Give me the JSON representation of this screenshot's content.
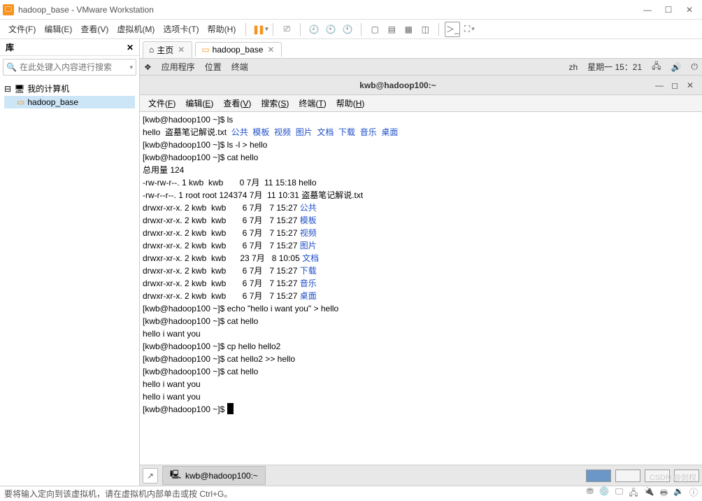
{
  "window": {
    "title": "hadoop_base - VMware Workstation"
  },
  "menubar": [
    {
      "label": "文件(F)"
    },
    {
      "label": "编辑(E)"
    },
    {
      "label": "查看(V)"
    },
    {
      "label": "虚拟机(M)"
    },
    {
      "label": "选项卡(T)"
    },
    {
      "label": "帮助(H)"
    }
  ],
  "sidebar": {
    "title": "库",
    "search_placeholder": "在此处键入内容进行搜索",
    "tree": {
      "root": "我的计算机",
      "child": "hadoop_base"
    }
  },
  "tabs": [
    {
      "label": "主页",
      "closable": true,
      "active": false
    },
    {
      "label": "hadoop_base",
      "closable": true,
      "active": true
    }
  ],
  "gnome": {
    "menus": [
      "应用程序",
      "位置",
      "终端"
    ],
    "lang": "zh",
    "clock": "星期一 15：21"
  },
  "term_window": {
    "title": "kwb@hadoop100:~",
    "menus": [
      {
        "t": "文件",
        "u": "F"
      },
      {
        "t": "编辑",
        "u": "E"
      },
      {
        "t": "查看",
        "u": "V"
      },
      {
        "t": "搜索",
        "u": "S"
      },
      {
        "t": "终端",
        "u": "T"
      },
      {
        "t": "帮助",
        "u": "H"
      }
    ]
  },
  "terminal_lines": [
    {
      "segs": [
        {
          "t": "[kwb@hadoop100 ~]$ ls"
        }
      ]
    },
    {
      "segs": [
        {
          "t": "hello  盗墓笔记解说.txt  "
        },
        {
          "t": "公共  模板  视频  图片  文档  下载  音乐  桌面",
          "c": "blue"
        }
      ]
    },
    {
      "segs": [
        {
          "t": "[kwb@hadoop100 ~]$ ls -l > hello"
        }
      ]
    },
    {
      "segs": [
        {
          "t": "[kwb@hadoop100 ~]$ cat hello"
        }
      ]
    },
    {
      "segs": [
        {
          "t": "总用量 124"
        }
      ]
    },
    {
      "segs": [
        {
          "t": "-rw-rw-r--. 1 kwb  kwb       0 7月  11 15:18 hello"
        }
      ]
    },
    {
      "segs": [
        {
          "t": "-rw-r--r--. 1 root root 124374 7月  11 10:31 盗墓笔记解说.txt"
        }
      ]
    },
    {
      "segs": [
        {
          "t": "drwxr-xr-x. 2 kwb  kwb       6 7月   7 15:27 "
        },
        {
          "t": "公共",
          "c": "blue"
        }
      ]
    },
    {
      "segs": [
        {
          "t": "drwxr-xr-x. 2 kwb  kwb       6 7月   7 15:27 "
        },
        {
          "t": "模板",
          "c": "blue"
        }
      ]
    },
    {
      "segs": [
        {
          "t": "drwxr-xr-x. 2 kwb  kwb       6 7月   7 15:27 "
        },
        {
          "t": "视频",
          "c": "blue"
        }
      ]
    },
    {
      "segs": [
        {
          "t": "drwxr-xr-x. 2 kwb  kwb       6 7月   7 15:27 "
        },
        {
          "t": "图片",
          "c": "blue"
        }
      ]
    },
    {
      "segs": [
        {
          "t": "drwxr-xr-x. 2 kwb  kwb      23 7月   8 10:05 "
        },
        {
          "t": "文档",
          "c": "blue"
        }
      ]
    },
    {
      "segs": [
        {
          "t": "drwxr-xr-x. 2 kwb  kwb       6 7月   7 15:27 "
        },
        {
          "t": "下载",
          "c": "blue"
        }
      ]
    },
    {
      "segs": [
        {
          "t": "drwxr-xr-x. 2 kwb  kwb       6 7月   7 15:27 "
        },
        {
          "t": "音乐",
          "c": "blue"
        }
      ]
    },
    {
      "segs": [
        {
          "t": "drwxr-xr-x. 2 kwb  kwb       6 7月   7 15:27 "
        },
        {
          "t": "桌面",
          "c": "blue"
        }
      ]
    },
    {
      "segs": [
        {
          "t": "[kwb@hadoop100 ~]$ echo \"hello i want you\" > hello"
        }
      ]
    },
    {
      "segs": [
        {
          "t": "[kwb@hadoop100 ~]$ cat hello"
        }
      ]
    },
    {
      "segs": [
        {
          "t": "hello i want you"
        }
      ]
    },
    {
      "segs": [
        {
          "t": "[kwb@hadoop100 ~]$ cp hello hello2"
        }
      ]
    },
    {
      "segs": [
        {
          "t": "[kwb@hadoop100 ~]$ cat hello2 >> hello"
        }
      ]
    },
    {
      "segs": [
        {
          "t": "[kwb@hadoop100 ~]$ cat hello"
        }
      ]
    },
    {
      "segs": [
        {
          "t": "hello i want you"
        }
      ]
    },
    {
      "segs": [
        {
          "t": "hello i want you"
        }
      ]
    },
    {
      "segs": [
        {
          "t": "[kwb@hadoop100 ~]$ "
        },
        {
          "cursor": true
        }
      ]
    }
  ],
  "taskbar": {
    "item": "kwb@hadoop100:~"
  },
  "statusbar": {
    "hint": "要将输入定向到该虚拟机，请在虚拟机内部单击或按 Ctrl+G。"
  },
  "watermark": "CSDN @剑权"
}
